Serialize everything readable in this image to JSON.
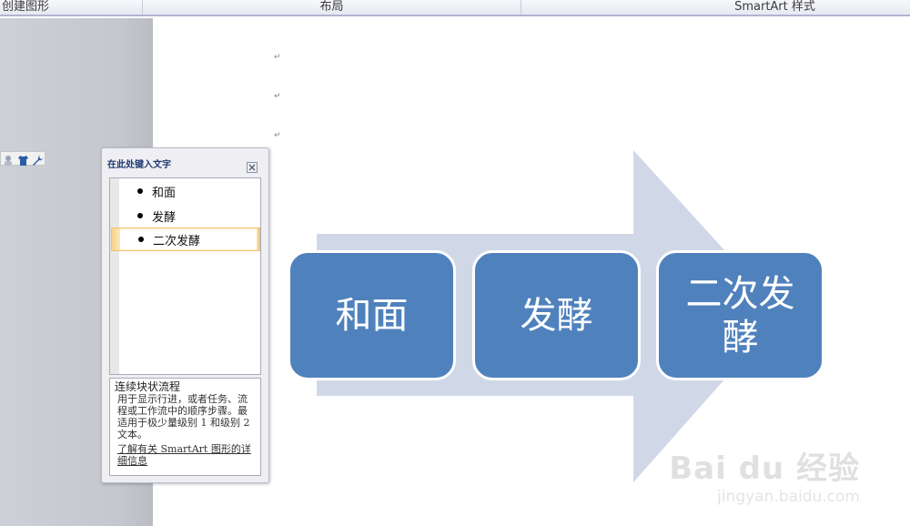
{
  "ribbon": {
    "groups": [
      "创建图形",
      "布局",
      "SmartArt 样式"
    ]
  },
  "document": {
    "paragraph_mark": "↵"
  },
  "text_pane": {
    "title": "在此处键入文字",
    "items": [
      "和面",
      "发酵",
      "二次发酵"
    ],
    "selected_index": 2,
    "layout_name": "连续块状流程",
    "layout_description": "用于显示行进，或者任务、流程或工作流中的顺序步骤。最适用于极少量级别 1 和级别 2 文本。",
    "learn_more": "了解有关 SmartArt 图形的详细信息"
  },
  "diagram": {
    "blocks": [
      "和面",
      "发酵",
      "二次发酵"
    ]
  },
  "watermark": {
    "logo": "Bai du 经验",
    "url": "jingyan.baidu.com"
  },
  "colors": {
    "block_fill": "#4f81bd",
    "arrow_fill": "#d0d8e8",
    "selection": "#f3c070"
  },
  "icons": [
    "recolor-icon",
    "shirt-icon",
    "wrench-icon",
    "close-icon"
  ]
}
